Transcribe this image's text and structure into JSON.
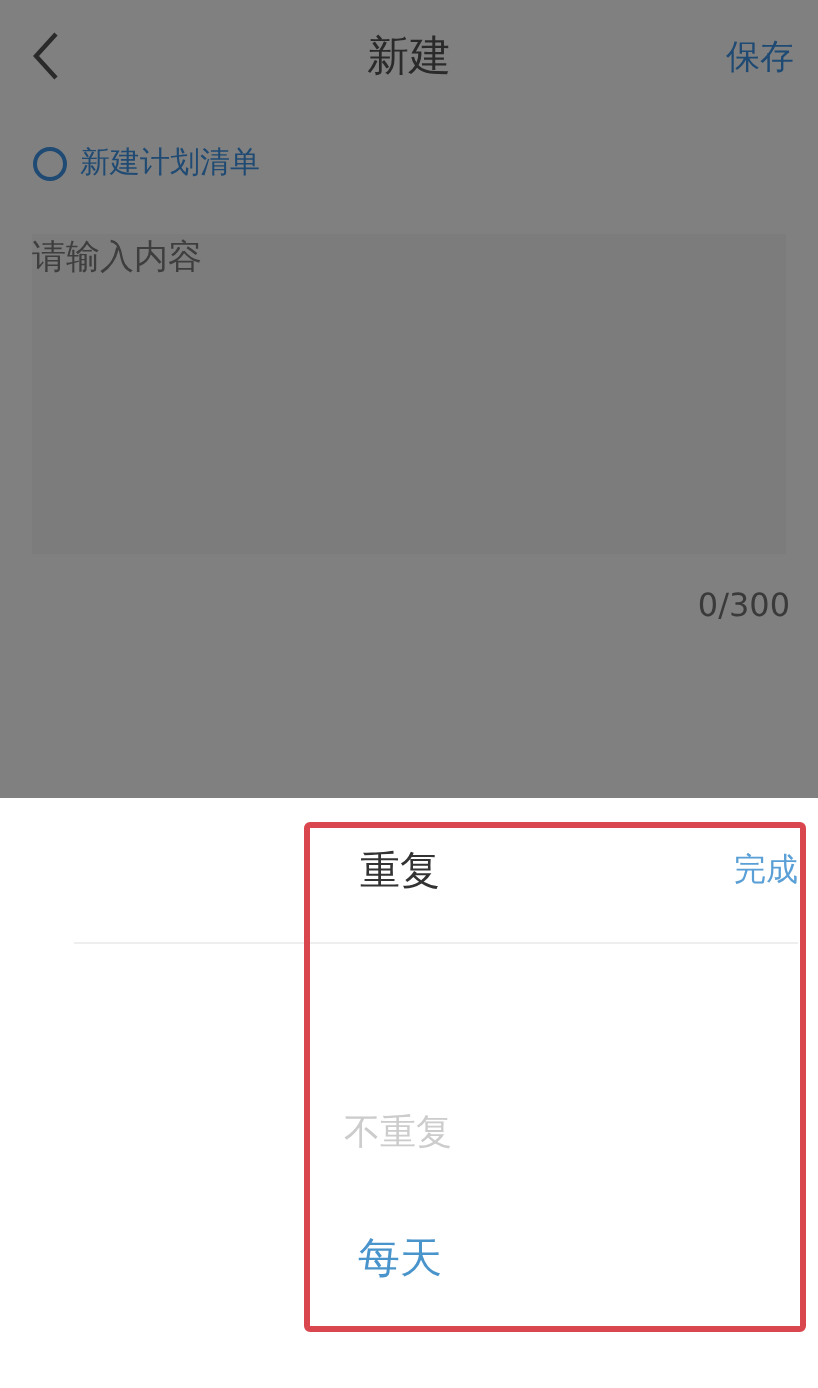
{
  "header": {
    "title": "新建",
    "action": "保存"
  },
  "plan_list": {
    "label": "新建计划清单"
  },
  "content": {
    "placeholder": "请输入内容",
    "counter": "0/300"
  },
  "sheet": {
    "title": "重复",
    "done": "完成",
    "options": [
      {
        "label": "不重复",
        "selected": false
      },
      {
        "label": "每天",
        "selected": true
      }
    ]
  }
}
